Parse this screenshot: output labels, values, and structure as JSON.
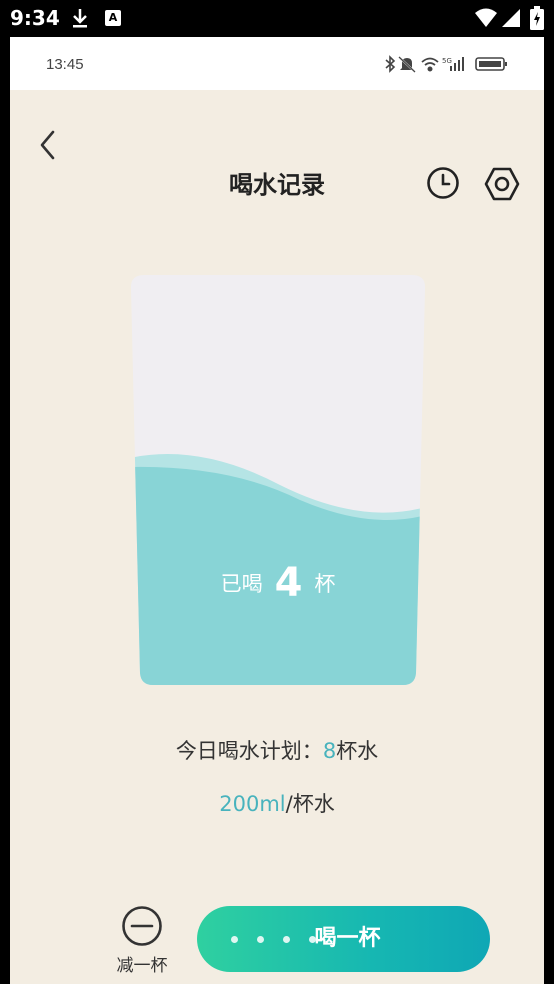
{
  "device_status": {
    "time": "9:34",
    "notification_icons": [
      "download-icon",
      "a-app-icon"
    ],
    "status_icons": [
      "wifi-icon",
      "signal-icon",
      "battery-icon"
    ]
  },
  "phone_status": {
    "time": "13:45",
    "icons": [
      "bluetooth-icon",
      "mute-icon",
      "wifi-icon",
      "signal-icon",
      "battery-icon"
    ]
  },
  "header": {
    "title": "喝水记录",
    "back_icon": "chevron-left-icon",
    "history_icon": "clock-icon",
    "settings_icon": "hexagon-settings-icon"
  },
  "cup": {
    "prefix": "已喝",
    "count": "4",
    "suffix": "杯",
    "fill_fraction": 0.5,
    "colors": {
      "water": "#88d4d6",
      "wave_light": "#b5e4e5",
      "empty": "#f0eef2"
    }
  },
  "plan": {
    "label": "今日喝水计划：",
    "count": "8",
    "unit": "杯水"
  },
  "volume": {
    "amount": "200ml",
    "unit": "/杯水"
  },
  "actions": {
    "minus_label": "减一杯",
    "drink_label": "喝一杯"
  },
  "colors": {
    "background": "#f3ede2",
    "accent": "#48b3bd",
    "button_gradient_start": "#2fd0a0",
    "button_gradient_end": "#0fa7b5"
  }
}
